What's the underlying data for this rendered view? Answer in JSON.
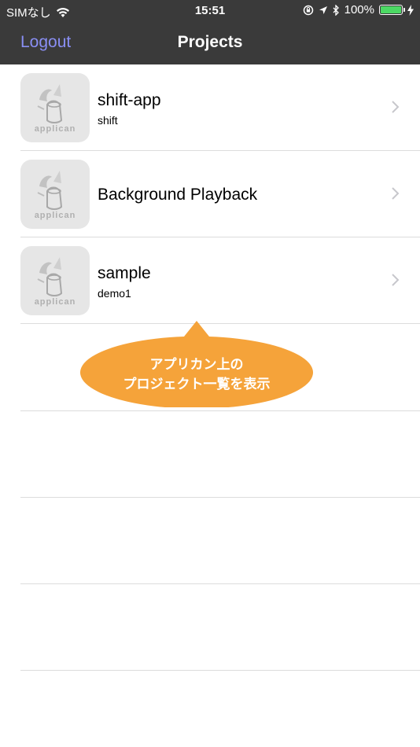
{
  "status_bar": {
    "carrier": "SIMなし",
    "time": "15:51",
    "battery": "100%",
    "battery_level": 1.0
  },
  "nav": {
    "logout_label": "Logout",
    "title": "Projects"
  },
  "projects": [
    {
      "title": "shift-app",
      "subtitle": "shift",
      "icon_text": "applican"
    },
    {
      "title": "Background Playback",
      "subtitle": "",
      "icon_text": "applican"
    },
    {
      "title": "sample",
      "subtitle": "demo1",
      "icon_text": "applican"
    }
  ],
  "callout": {
    "line1": "アプリカン上の",
    "line2": "プロジェクト一覧を表示",
    "color": "#f5a33a"
  }
}
